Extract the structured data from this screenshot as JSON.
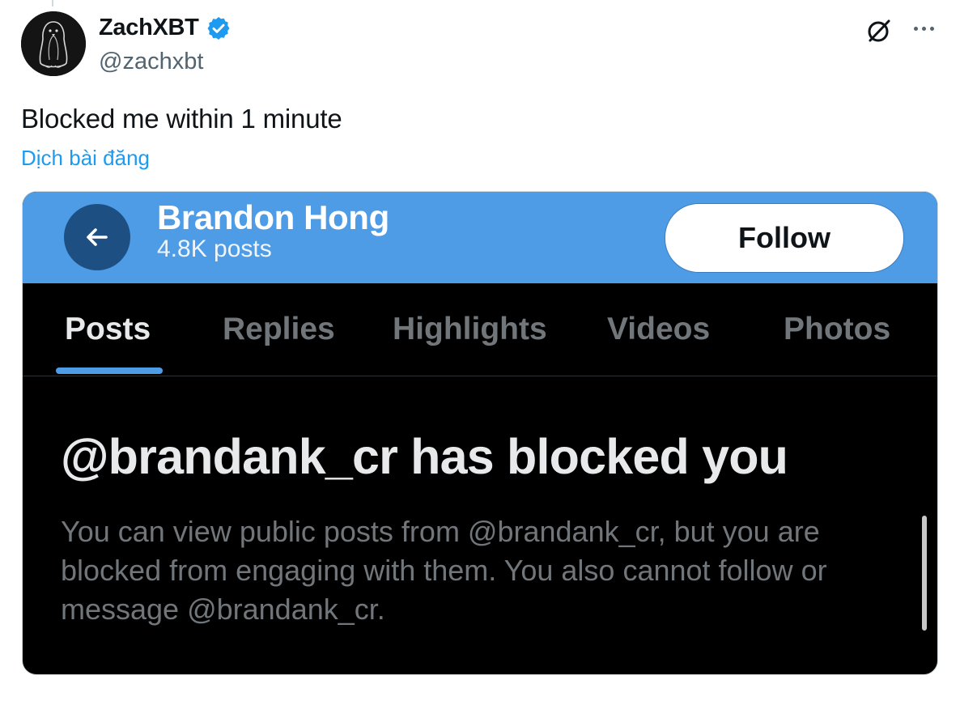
{
  "tweet": {
    "author_name": "ZachXBT",
    "handle": "@zachxbt",
    "text": "Blocked me within 1 minute",
    "translate_label": "Dịch bài đăng",
    "icons": [
      "avatar",
      "verified-badge-icon",
      "grok-icon",
      "more-icon"
    ]
  },
  "embedded_screenshot": {
    "profile_name": "Brandon Hong",
    "post_count": "4.8K posts",
    "follow_label": "Follow",
    "tabs": [
      {
        "label": "Posts",
        "active": true
      },
      {
        "label": "Replies",
        "active": false
      },
      {
        "label": "Highlights",
        "active": false
      },
      {
        "label": "Videos",
        "active": false
      },
      {
        "label": "Photos",
        "active": false
      }
    ],
    "blocked_title": "@brandank_cr has blocked you",
    "blocked_body": "You can view public posts from @brandank_cr, but you are blocked from engaging with them. You also cannot follow or message @brandank_cr."
  },
  "colors": {
    "link": "#1d9bf0",
    "header_blue": "#4e9be6",
    "back_button": "#1d4f82",
    "dark_bg": "#000000",
    "muted_text": "#536471"
  }
}
